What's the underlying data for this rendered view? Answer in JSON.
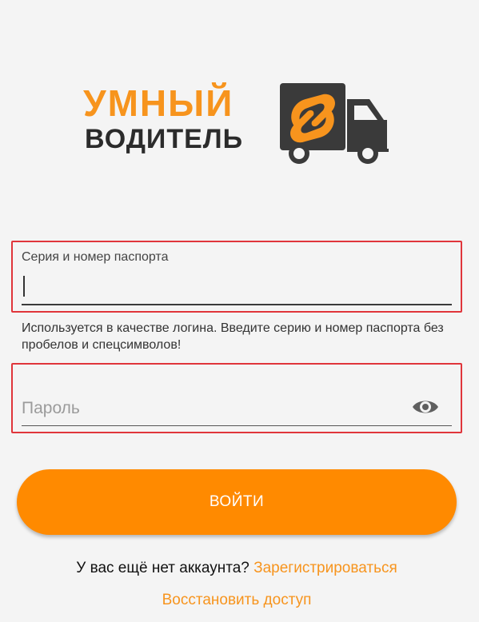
{
  "logo": {
    "line1": "УМНЫЙ",
    "line2": "ВОДИТЕЛЬ",
    "brand_color": "#f7941d",
    "dark_color": "#2b2b2b"
  },
  "passport_field": {
    "label": "Серия и номер паспорта",
    "value": "",
    "helper": "Используется в качестве логина. Введите серию и номер паспорта без пробелов и спецсимволов!"
  },
  "password_field": {
    "placeholder": "Пароль",
    "toggle_icon": "eye-icon"
  },
  "login_button": {
    "label": "ВОЙТИ",
    "color": "#ff8a00"
  },
  "signup": {
    "prompt": "У вас ещё нет аккаунта?",
    "link": "Зарегистрироваться"
  },
  "restore": {
    "link": "Восстановить доступ"
  },
  "highlight_color": "#e0353b"
}
